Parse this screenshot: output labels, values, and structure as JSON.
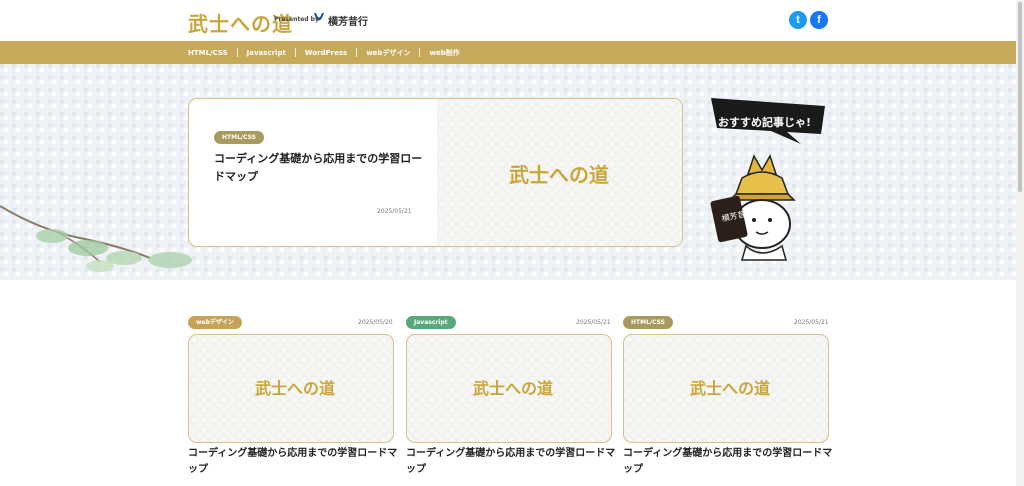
{
  "header": {
    "logo_text": "武士への道",
    "presented_by": "Presented by",
    "brand_name": "横芳昔行"
  },
  "social": {
    "twitter_glyph": "t",
    "facebook_glyph": "f"
  },
  "nav": {
    "items": [
      "HTML/CSS",
      "Javascript",
      "WordPress",
      "webデザイン",
      "web制作"
    ]
  },
  "feature": {
    "category": "HTML/CSS",
    "title": "コーディング基礎から応用までの学習ロードマップ",
    "date": "2025/05/21",
    "thumb_logo": "武士への道"
  },
  "recommend": {
    "bubble": "おすすめ記事じゃ!",
    "sign": "横芳昔行"
  },
  "cards": [
    {
      "category": "webデザイン",
      "date": "2025/05/20",
      "title": "コーディング基礎から応用までの学習ロードマップ",
      "thumb_logo": "武士への道"
    },
    {
      "category": "Javascript",
      "date": "2025/05/21",
      "title": "コーディング基礎から応用までの学習ロードマップ",
      "thumb_logo": "武士への道"
    },
    {
      "category": "HTML/CSS",
      "date": "2025/05/21",
      "title": "コーディング基礎から応用までの学習ロードマップ",
      "thumb_logo": "武士への道"
    }
  ],
  "colors": {
    "gold": "#c6a95a",
    "badge_olive": "#a89a5f",
    "badge_tan": "#c7a35a",
    "badge_green": "#5aa77a",
    "twitter": "#1d9bf0",
    "facebook": "#1877f2"
  }
}
